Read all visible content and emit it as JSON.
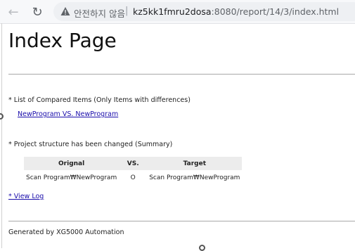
{
  "browser": {
    "security_label": "안전하지 않음",
    "separator": "|",
    "url_host": "kz5kk1fmru2dosa",
    "url_rest": ":8080/report/14/3/index.html"
  },
  "page": {
    "title": "Index Page",
    "compared_heading": "* List of Compared Items (Only Items with differences)",
    "compared_link": "NewProgram VS. NewProgram",
    "structure_heading": "* Project structure has been changed (Summary)",
    "table": {
      "headers": [
        "Orignal",
        "VS.",
        "Target"
      ],
      "rows": [
        {
          "original": "Scan Program₩NewProgram",
          "vs": "O",
          "target": "Scan Program₩NewProgram"
        }
      ]
    },
    "view_log": "* View Log",
    "footer": "Generated by XG5000 Automation"
  }
}
